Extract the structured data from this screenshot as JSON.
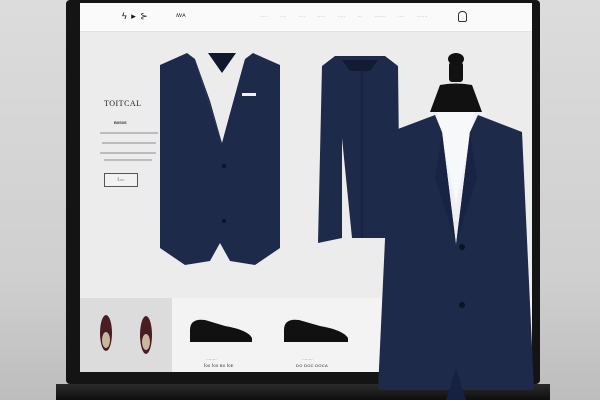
{
  "header": {
    "logo": "ϟ ▸ ⊱",
    "brand": "ꟿ𐌀",
    "nav": [
      "·····",
      "····",
      "····",
      "·····",
      "·····",
      "···",
      "·······",
      "····",
      "·······"
    ]
  },
  "hero": {
    "title": "TOITCAL",
    "subtitle": "B0S0S",
    "button": "ꟾ.○○"
  },
  "shoes": [
    {
      "label": "ꟾ00 ꟾ00 B0 ꟾ0E",
      "price": "········"
    },
    {
      "label": "DO DOC DOCA",
      "price": "········"
    }
  ],
  "colors": {
    "suit": "#1e2a4a",
    "screen": "#ececec",
    "frame": "#141414"
  }
}
